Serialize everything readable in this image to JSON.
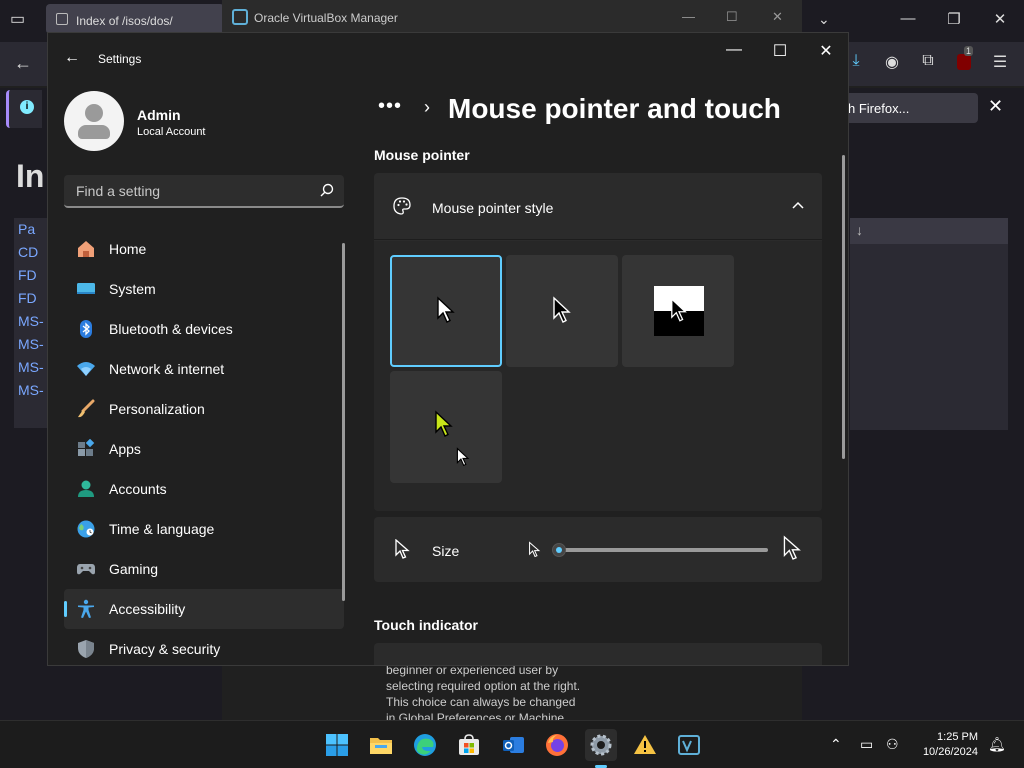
{
  "firefox": {
    "tab_title": "Index of /isos/dos/",
    "notification_button": "h Firefox...",
    "page_heading": "In",
    "page_list": [
      "Pa",
      "CD",
      "FD",
      "FD",
      "MS-",
      "MS-",
      "MS-",
      "MS-"
    ],
    "sort_arrow": "↓",
    "extension_badge": "1"
  },
  "virtualbox": {
    "title": "Oracle VirtualBox Manager",
    "description_lines": [
      "beginner or experienced user by",
      "selecting required option at the right.",
      "This choice can always be changed",
      "in Global Preferences or Machine"
    ]
  },
  "settings": {
    "app_title": "Settings",
    "profile": {
      "name": "Admin",
      "account_type": "Local Account"
    },
    "search": {
      "placeholder": "Find a setting"
    },
    "nav": [
      {
        "label": "Home",
        "icon": "home-icon"
      },
      {
        "label": "System",
        "icon": "system-icon"
      },
      {
        "label": "Bluetooth & devices",
        "icon": "bluetooth-icon"
      },
      {
        "label": "Network & internet",
        "icon": "network-icon"
      },
      {
        "label": "Personalization",
        "icon": "brush-icon"
      },
      {
        "label": "Apps",
        "icon": "apps-icon"
      },
      {
        "label": "Accounts",
        "icon": "accounts-icon"
      },
      {
        "label": "Time & language",
        "icon": "globe-icon"
      },
      {
        "label": "Gaming",
        "icon": "gamepad-icon"
      },
      {
        "label": "Accessibility",
        "icon": "accessibility-icon",
        "active": true
      },
      {
        "label": "Privacy & security",
        "icon": "shield-icon"
      }
    ],
    "breadcrumb": {
      "ellipsis": "•••",
      "separator": "›",
      "title": "Mouse pointer and touch"
    },
    "sections": {
      "mouse_pointer": "Mouse pointer",
      "touch_indicator": "Touch indicator"
    },
    "pointer_style": {
      "label": "Mouse pointer style",
      "options": [
        "white",
        "black",
        "inverted",
        "custom"
      ],
      "selected": "white",
      "custom_color": "#c8e619"
    },
    "size": {
      "label": "Size",
      "value_fraction": 0.0
    }
  },
  "taskbar": {
    "apps": [
      "start-icon",
      "file-explorer-icon",
      "edge-icon",
      "store-icon",
      "outlook-icon",
      "firefox-icon",
      "settings-icon",
      "warning-icon",
      "virtualbox-icon"
    ],
    "active_app": "settings-icon",
    "time": "1:25 PM",
    "date": "10/26/2024"
  },
  "colors": {
    "accent": "#60cdff",
    "window_bg": "#202020",
    "card_bg": "#2b2b2b"
  }
}
